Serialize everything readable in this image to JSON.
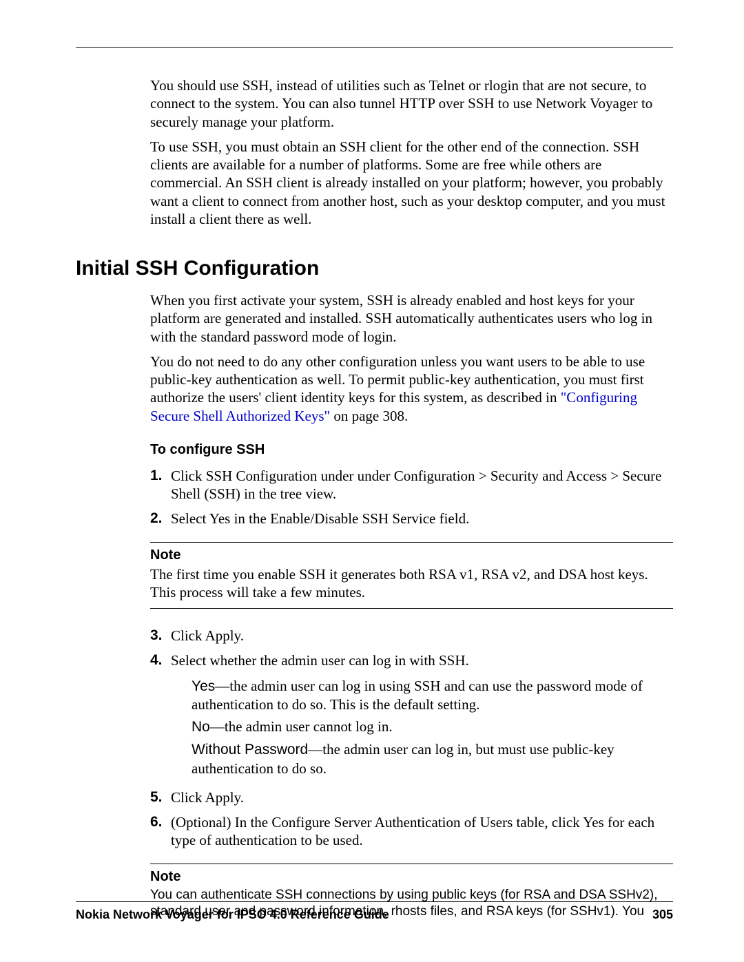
{
  "intro": {
    "p1": "You should use SSH, instead of utilities such as Telnet or rlogin that are not secure, to connect to the system. You can also tunnel HTTP over SSH to use Network Voyager to securely manage your platform.",
    "p2": "To use SSH, you must obtain an SSH client for the other end of the connection. SSH clients are available for a number of platforms. Some are free while others are commercial. An SSH client is already installed on your platform; however, you probably want a client to connect from another host, such as your desktop computer, and you must install a client there as well."
  },
  "section": {
    "heading": "Initial SSH Configuration",
    "p1": "When you first activate your system, SSH is already enabled and host keys for your platform are generated and installed. SSH automatically authenticates users who log in with the standard password mode of login.",
    "p2a": "You do not need to do any other configuration unless you want users to be able to use public-key authentication as well. To permit public-key authentication, you must first authorize the users' client identity keys for this system, as described in ",
    "xref": "\"Configuring Secure Shell Authorized Keys\"",
    "p2b": " on page 308.",
    "subheading": "To configure SSH",
    "steps": {
      "s1": {
        "num": "1.",
        "text": "Click SSH Configuration under under Configuration > Security and Access > Secure Shell (SSH) in the tree view."
      },
      "s2": {
        "num": "2.",
        "text": "Select Yes in the Enable/Disable SSH Service field."
      },
      "s3": {
        "num": "3.",
        "text": "Click Apply."
      },
      "s4": {
        "num": "4.",
        "text": "Select whether the admin user can log in with SSH."
      },
      "s5": {
        "num": "5.",
        "text": "Click Apply."
      },
      "s6": {
        "num": "6.",
        "text": "(Optional) In the Configure Server Authentication of Users table, click Yes for each type of authentication to be used."
      }
    },
    "note1": {
      "label": "Note",
      "text": "The first time you enable SSH it generates both RSA v1, RSA v2, and DSA host keys. This process will take a few minutes."
    },
    "options": {
      "yes": {
        "label": "Yes",
        "text": "—the admin user can log in using SSH and can use the password mode of authentication to do so. This is the default setting."
      },
      "no": {
        "label": "No",
        "text": "—the admin user cannot log in."
      },
      "without": {
        "label": "Without Password",
        "text": "—the admin user can log in, but must use public-key authentication to do so."
      }
    },
    "note2": {
      "label": "Note",
      "text": "You can authenticate SSH connections by using public keys (for RSA and DSA SSHv2), standard user and password information, rhosts files, and RSA keys (for SSHv1). You"
    }
  },
  "footer": {
    "title": "Nokia Network Voyager for IPSO 4.0 Reference Guide",
    "page": "305"
  }
}
